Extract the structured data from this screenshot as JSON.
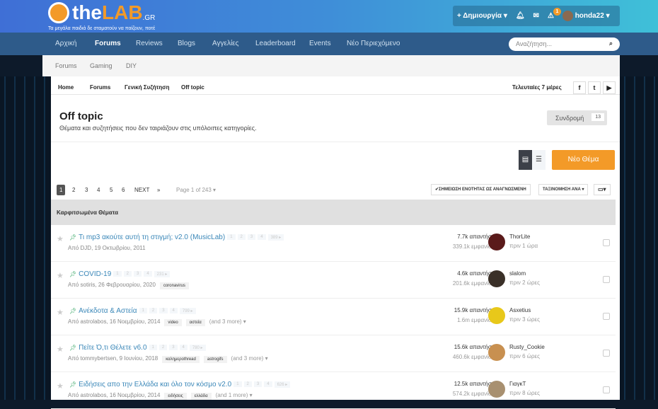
{
  "brand": {
    "name_a": "the",
    "name_b": "LAB",
    "suffix": ".GR",
    "tagline": "Τα μεγάλα παιδιά δε σταματούν να παίζουν, ποτέ"
  },
  "userbar": {
    "create": "+ Δημιουργία ▾",
    "notif_count": "1",
    "username": "honda22 ▾"
  },
  "nav": [
    "Αρχική",
    "Forums",
    "Reviews",
    "Blogs",
    "Αγγελίες",
    "Leaderboard",
    "Events",
    "Νέο Περιεχόμενο"
  ],
  "search_placeholder": "Αναζήτηση...",
  "subnav": [
    "Forums",
    "Gaming",
    "DIY"
  ],
  "breadcrumb": [
    "Home",
    "Forums",
    "Γενική Συζήτηση",
    "Off topic"
  ],
  "last7": "Τελευταίες 7 μέρες",
  "social": [
    "f",
    "t",
    "▶"
  ],
  "page": {
    "title": "Off topic",
    "description": "Θέματα και συζητήσεις που δεν ταιριάζουν στις υπόλοιπες κατηγορίες.",
    "follow": "Συνδρομή",
    "follow_count": "13",
    "new_topic": "Νέο Θέμα"
  },
  "pagination": {
    "pages": [
      "1",
      "2",
      "3",
      "4",
      "5",
      "6"
    ],
    "next": "NEXT",
    "last": "»",
    "page_of": "Page 1 of 243 ▾"
  },
  "toolbar": {
    "mark_read": "✔ΣΗΜΕΙΩΣΗ ΕΝΟΤΗΤΑΣ ΩΣ ΑΝΑΓΝΩΣΜΕΝΗ",
    "sort": "ΤΑΞΙΝΟΜΗΣΗ ΑΝΑ ▾"
  },
  "pinned_header": "Καρφιτσωμένα Θέματα",
  "topics": [
    {
      "title": "Τι mp3 ακούτε αυτή τη στιγμή; v2.0 (MusicLab)",
      "last_page": "389 ▸",
      "meta": "Από DJD, 19 Οκτωβρίου, 2011",
      "tags": [],
      "more": "",
      "replies": "7.7k απαντήσεις",
      "views": "339.1k εμφανίσεις",
      "user": "ThorLite",
      "time": "πριν 1 ώρα",
      "avatar": "#5a1a1a"
    },
    {
      "title": "COVID-19",
      "last_page": "231 ▸",
      "meta": "Από sotiris, 26 Φεβρουαρίου, 2020",
      "tags": [
        "coronavirus"
      ],
      "more": "",
      "replies": "4.6k απαντήσεις",
      "views": "201.6k εμφανίσεις",
      "user": "slalom",
      "time": "πριν 2 ώρες",
      "avatar": "#3a3028"
    },
    {
      "title": "Ανέκδοτα & Αστεία",
      "last_page": "799 ▸",
      "meta": "Από astrolabos, 16 Νοεμβρίου, 2014",
      "tags": [
        "video",
        "αστεία"
      ],
      "more": "(and 3 more) ▾",
      "replies": "15.9k απαντήσεις",
      "views": "1.6m εμφανίσεις",
      "user": "Asxetius",
      "time": "πριν 3 ώρες",
      "avatar": "#e8c81a"
    },
    {
      "title": "Πείτε Ό,τι Θέλετε v6.0",
      "last_page": "780 ▸",
      "meta": "Από tommybertsen, 9 Ιουνίου, 2018",
      "tags": [
        "καλημεροthread",
        "astrogifs"
      ],
      "more": "(and 3 more) ▾",
      "replies": "15.6k απαντήσεις",
      "views": "460.6k εμφανίσεις",
      "user": "Rusty_Cookie",
      "time": "πριν 6 ώρες",
      "avatar": "#c89050"
    },
    {
      "title": "Ειδήσεις απο την Ελλάδα και όλο τον κόσμο v2.0",
      "last_page": "626 ▸",
      "meta": "Από astrolabos, 16 Νοεμβρίου, 2014",
      "tags": [
        "ειδήσεις",
        "ελλάδα"
      ],
      "more": "(and 1 more) ▾",
      "replies": "12.5k απαντήσεις",
      "views": "574.2k εμφανίσεις",
      "user": "ΓιαγκΤ",
      "time": "πριν 8 ώρες",
      "avatar": "#a89070"
    }
  ]
}
